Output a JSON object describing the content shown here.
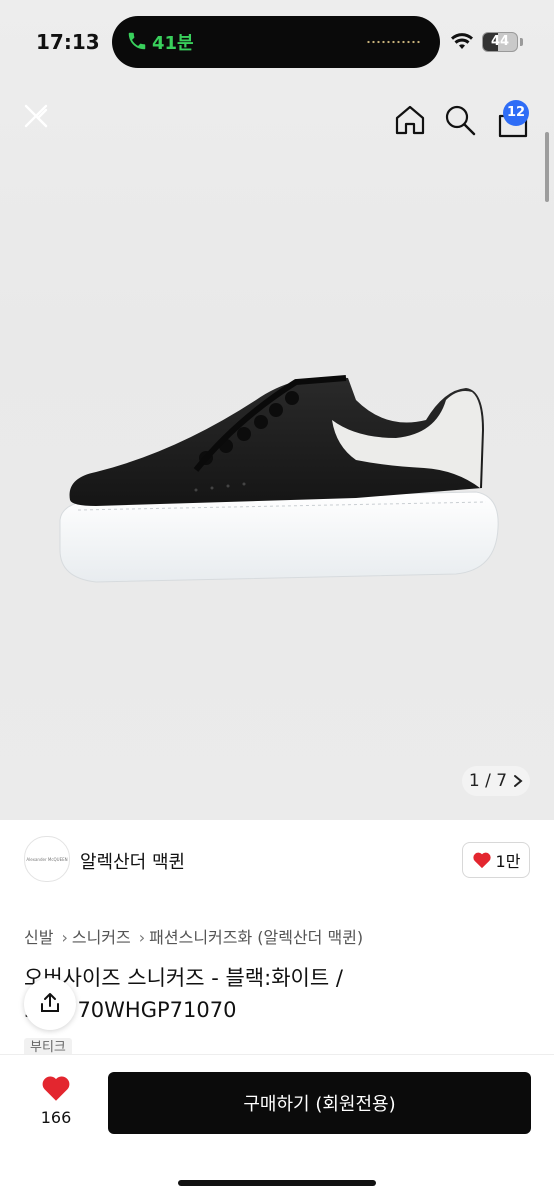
{
  "status_bar": {
    "time": "17:13",
    "call_duration": "41분",
    "battery": "44",
    "battery_level_percent": 44
  },
  "header": {
    "close_icon": "close-back-icon",
    "home_icon": "home-icon",
    "search_icon": "search-icon",
    "cart_icon": "shopping-bag-icon",
    "cart_count": "12"
  },
  "gallery": {
    "current": "1",
    "total": "7",
    "pager_text": "1 / 7",
    "next_icon": "chevron-right-icon"
  },
  "brand": {
    "logo_text": "Alexander McQUEEN",
    "name": "알렉산더 맥퀸",
    "likes": "1만",
    "like_icon": "heart-icon"
  },
  "breadcrumb": [
    "신발",
    "스니커즈",
    "패션스니커즈화 (알렉산더 맥퀸)"
  ],
  "product": {
    "title": "오버사이즈 스니커즈 - 블랙:화이트 / 553770WHGP71070",
    "shop_tag": "부티크"
  },
  "actions": {
    "share_icon": "share-icon",
    "wish_icon": "heart-icon",
    "wish_count": "166",
    "buy_label": "구매하기 (회원전용)"
  },
  "colors": {
    "accent_badge": "#2f6df6",
    "heart_red": "#e3262f",
    "buy_button": "#0b0b0b",
    "call_green": "#39d05c"
  }
}
